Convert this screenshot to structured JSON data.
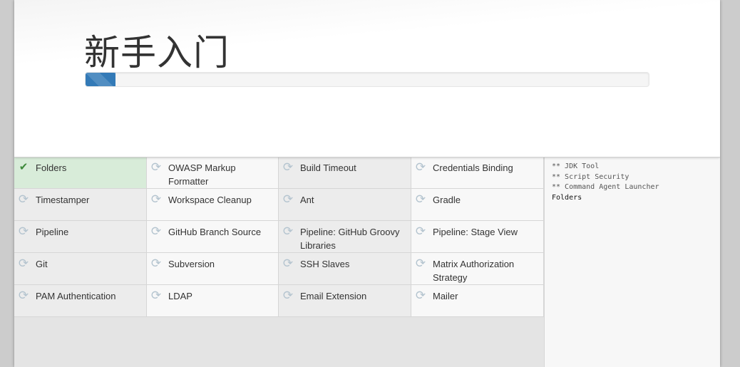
{
  "header": {
    "title": "新手入门",
    "progress_percent": 5.3
  },
  "plugins": [
    {
      "label": "Folders",
      "status": "success"
    },
    {
      "label": "OWASP Markup Formatter",
      "status": "pending"
    },
    {
      "label": "Build Timeout",
      "status": "pending"
    },
    {
      "label": "Credentials Binding",
      "status": "pending"
    },
    {
      "label": "Timestamper",
      "status": "pending"
    },
    {
      "label": "Workspace Cleanup",
      "status": "pending"
    },
    {
      "label": "Ant",
      "status": "pending"
    },
    {
      "label": "Gradle",
      "status": "pending"
    },
    {
      "label": "Pipeline",
      "status": "pending"
    },
    {
      "label": "GitHub Branch Source",
      "status": "pending"
    },
    {
      "label": "Pipeline: GitHub Groovy Libraries",
      "status": "pending"
    },
    {
      "label": "Pipeline: Stage View",
      "status": "pending"
    },
    {
      "label": "Git",
      "status": "pending"
    },
    {
      "label": "Subversion",
      "status": "pending"
    },
    {
      "label": "SSH Slaves",
      "status": "pending"
    },
    {
      "label": "Matrix Authorization Strategy",
      "status": "pending"
    },
    {
      "label": "PAM Authentication",
      "status": "pending"
    },
    {
      "label": "LDAP",
      "status": "pending"
    },
    {
      "label": "Email Extension",
      "status": "pending"
    },
    {
      "label": "Mailer",
      "status": "pending"
    }
  ],
  "icons": {
    "success": "check-icon",
    "pending": "refresh-icon"
  },
  "log": [
    "** JDK Tool",
    "** Script Security",
    "** Command Agent Launcher",
    "Folders"
  ],
  "colors": {
    "progress": "#337ab7",
    "success_bg": "#d8ecd9",
    "success_icon": "#3f8a3c",
    "pending_icon": "#b4c4cf"
  }
}
